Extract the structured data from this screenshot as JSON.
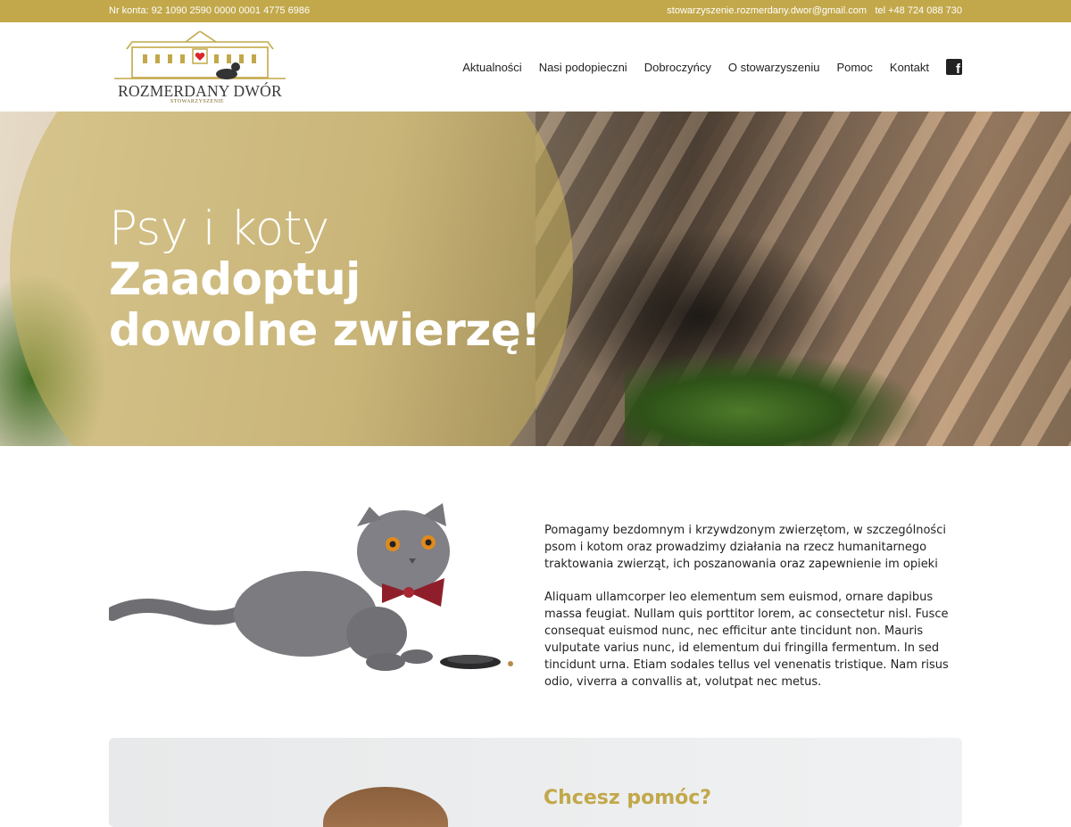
{
  "topbar": {
    "account": "Nr konta: 92 1090 2590 0000 0001 4775 6986",
    "email": "stowarzyszenie.rozmerdany.dwor@gmail.com",
    "phone": "tel +48 724 088 730",
    "background_color": "#c2a84a"
  },
  "logo": {
    "name": "ROZMERDANY DWÓR",
    "subtitle": "STOWARZYSZENIE",
    "icon": "manor-house-logo",
    "accent_color": "#c2a84a"
  },
  "nav": {
    "items": [
      "Aktualności",
      "Nasi podopieczni",
      "Dobroczyńcy",
      "O stowarzyszeniu",
      "Pomoc",
      "Kontakt"
    ],
    "social_icon": "facebook-icon"
  },
  "hero": {
    "line1": "Psy i koty",
    "line2": "Zaadoptuj dowolne zwierzę!",
    "image": "sleeping-cats-photo",
    "overlay_color": "#c8b25c"
  },
  "intro": {
    "image": "grey-cat-with-bow-tie-photo",
    "paragraph1": "Pomagamy bezdomnym i krzywdzonym zwierzętom, w szczególności psom i kotom oraz prowadzimy działania na rzecz humanitarnego traktowania zwierząt, ich poszanowania oraz zapewnienie im opieki",
    "paragraph2": "Aliquam ullamcorper leo elementum sem euismod, ornare dapibus massa feugiat. Nullam quis porttitor lorem, ac consectetur nisl. Fusce consequat euismod nunc, nec efficitur ante tincidunt non. Mauris vulputate varius nunc, id elementum dui fringilla fermentum. In sed tincidunt urna. Etiam sodales tellus vel venenatis tristique. Nam risus odio, viverra a convallis at, volutpat nec metus."
  },
  "help_card": {
    "title": "Chcesz pomóc?",
    "image": "puppy-photo"
  }
}
